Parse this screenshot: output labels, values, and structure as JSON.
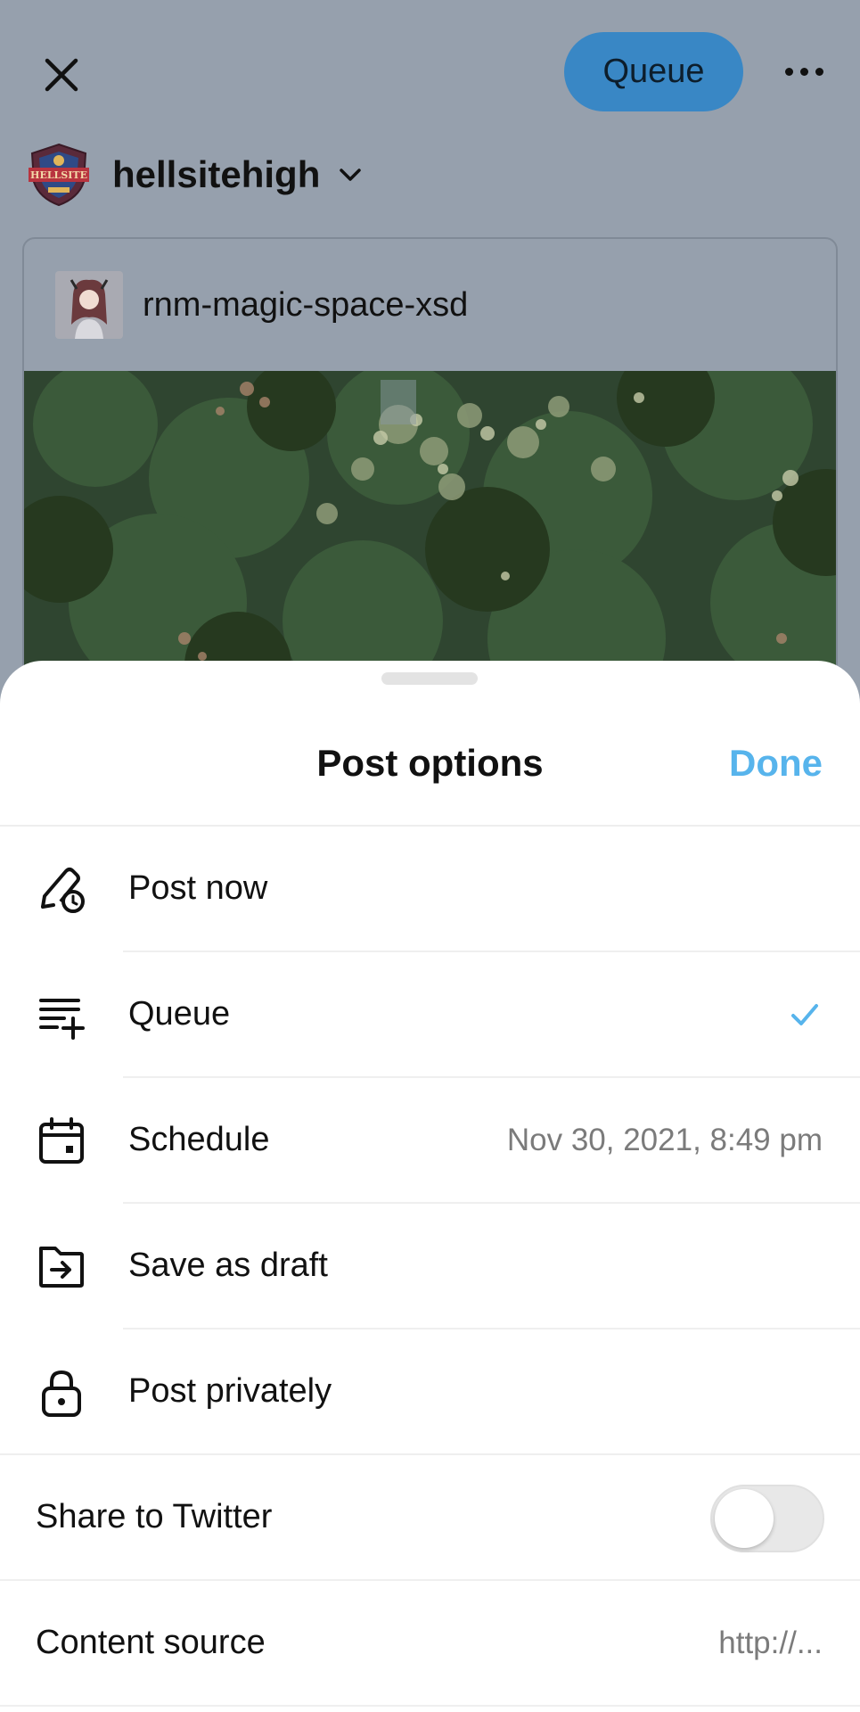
{
  "header": {
    "close_icon": "close-icon",
    "queue_button_label": "Queue",
    "more_icon": "more-horizontal-icon",
    "queue_button_color": "#3987c5"
  },
  "blog": {
    "name": "hellsitehigh",
    "avatar_text": "HELLSITE"
  },
  "reblog": {
    "username": "rnm-magic-space-xsd"
  },
  "sheet": {
    "title": "Post options",
    "done_label": "Done",
    "done_color": "#57b4ec",
    "options": [
      {
        "icon": "pencil-clock-icon",
        "label": "Post now",
        "value": "",
        "selected": false
      },
      {
        "icon": "queue-add-icon",
        "label": "Queue",
        "value": "",
        "selected": true
      },
      {
        "icon": "calendar-icon",
        "label": "Schedule",
        "value": "Nov 30, 2021, 8:49 pm",
        "selected": false
      },
      {
        "icon": "folder-arrow-icon",
        "label": "Save as draft",
        "value": "",
        "selected": false
      },
      {
        "icon": "lock-icon",
        "label": "Post privately",
        "value": "",
        "selected": false
      }
    ],
    "share_twitter": {
      "label": "Share to Twitter",
      "enabled": false
    },
    "content_source": {
      "label": "Content source",
      "value": "http://..."
    }
  }
}
